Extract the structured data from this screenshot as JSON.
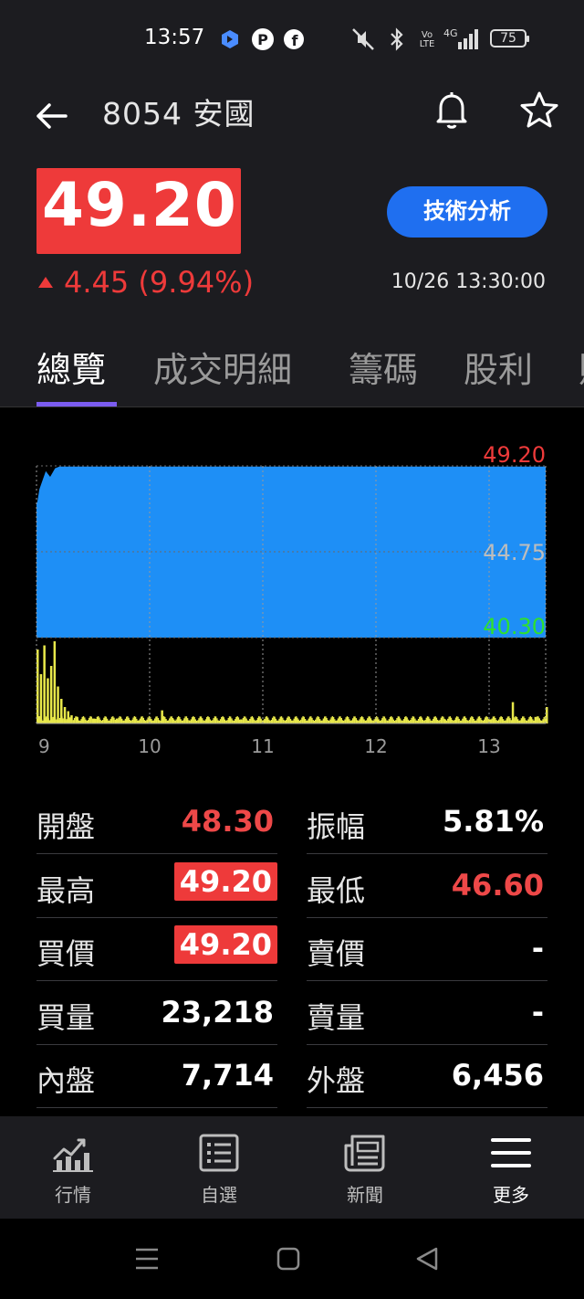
{
  "status_bar": {
    "time": "13:57",
    "network_label": "4G",
    "volte_label": "Vo LTE",
    "battery": "75"
  },
  "header": {
    "title": "8054 安國",
    "price": "49.20",
    "change": "4.45 (9.94%)",
    "timestamp": "10/26 13:30:00",
    "tech_button": "技術分析",
    "up_color": "#ee3a3a",
    "accent": "#1f6ff0"
  },
  "tabs": [
    {
      "label": "總覽",
      "active": true
    },
    {
      "label": "成交明細",
      "active": false
    },
    {
      "label": "籌碼",
      "active": false
    },
    {
      "label": "股利",
      "active": false
    }
  ],
  "chart_data": {
    "type": "area",
    "y_labels": {
      "high": "49.20",
      "mid": "44.75",
      "low": "40.30"
    },
    "ylim": [
      40.3,
      49.2
    ],
    "x_ticks": [
      "9",
      "10",
      "11",
      "12",
      "13"
    ],
    "x_range_hours": [
      9,
      13.5
    ],
    "price_series": {
      "x": [
        9.0,
        9.02,
        9.05,
        9.08,
        9.12,
        9.16,
        9.2,
        9.3,
        13.5
      ],
      "y": [
        47.3,
        48.0,
        48.5,
        49.0,
        48.7,
        49.1,
        49.2,
        49.2,
        49.2
      ]
    },
    "volume_series": {
      "x": [
        9.0,
        9.03,
        9.06,
        9.09,
        9.12,
        9.15,
        9.18,
        9.21,
        9.24,
        9.27,
        9.3,
        9.35,
        9.4,
        9.5,
        9.6,
        9.7,
        9.8,
        9.9,
        10.0,
        10.1,
        10.2,
        10.5,
        10.8,
        11.0,
        11.3,
        11.6,
        12.0,
        12.3,
        12.6,
        13.0,
        13.2,
        13.4,
        13.5
      ],
      "y": [
        90,
        60,
        95,
        55,
        70,
        100,
        45,
        30,
        20,
        15,
        10,
        8,
        7,
        6,
        5,
        6,
        5,
        4,
        5,
        16,
        5,
        4,
        5,
        4,
        5,
        4,
        5,
        4,
        5,
        5,
        26,
        8,
        20
      ]
    },
    "colors": {
      "area": "#1e8ff6",
      "volume": "#e8e84a",
      "high_label": "#ee3a3a",
      "mid_label": "#bdbdbd",
      "low_label": "#2fe02f"
    }
  },
  "quote_table": {
    "left": [
      {
        "label": "開盤",
        "value": "48.30",
        "style": "red"
      },
      {
        "label": "最高",
        "value": "49.20",
        "style": "boxed"
      },
      {
        "label": "買價",
        "value": "49.20",
        "style": "boxed"
      },
      {
        "label": "買量",
        "value": "23,218",
        "style": "white"
      },
      {
        "label": "內盤",
        "value": "7,714",
        "style": "white"
      }
    ],
    "right": [
      {
        "label": "振幅",
        "value": "5.81%",
        "style": "white"
      },
      {
        "label": "最低",
        "value": "46.60",
        "style": "red"
      },
      {
        "label": "賣價",
        "value": "-",
        "style": "white"
      },
      {
        "label": "賣量",
        "value": "-",
        "style": "white"
      },
      {
        "label": "外盤",
        "value": "6,456",
        "style": "white"
      }
    ]
  },
  "bottom_nav": [
    {
      "label": "行情",
      "icon": "market-chart-icon",
      "active": false
    },
    {
      "label": "自選",
      "icon": "watchlist-icon",
      "active": false
    },
    {
      "label": "新聞",
      "icon": "news-icon",
      "active": false
    },
    {
      "label": "更多",
      "icon": "menu-icon",
      "active": true
    }
  ]
}
